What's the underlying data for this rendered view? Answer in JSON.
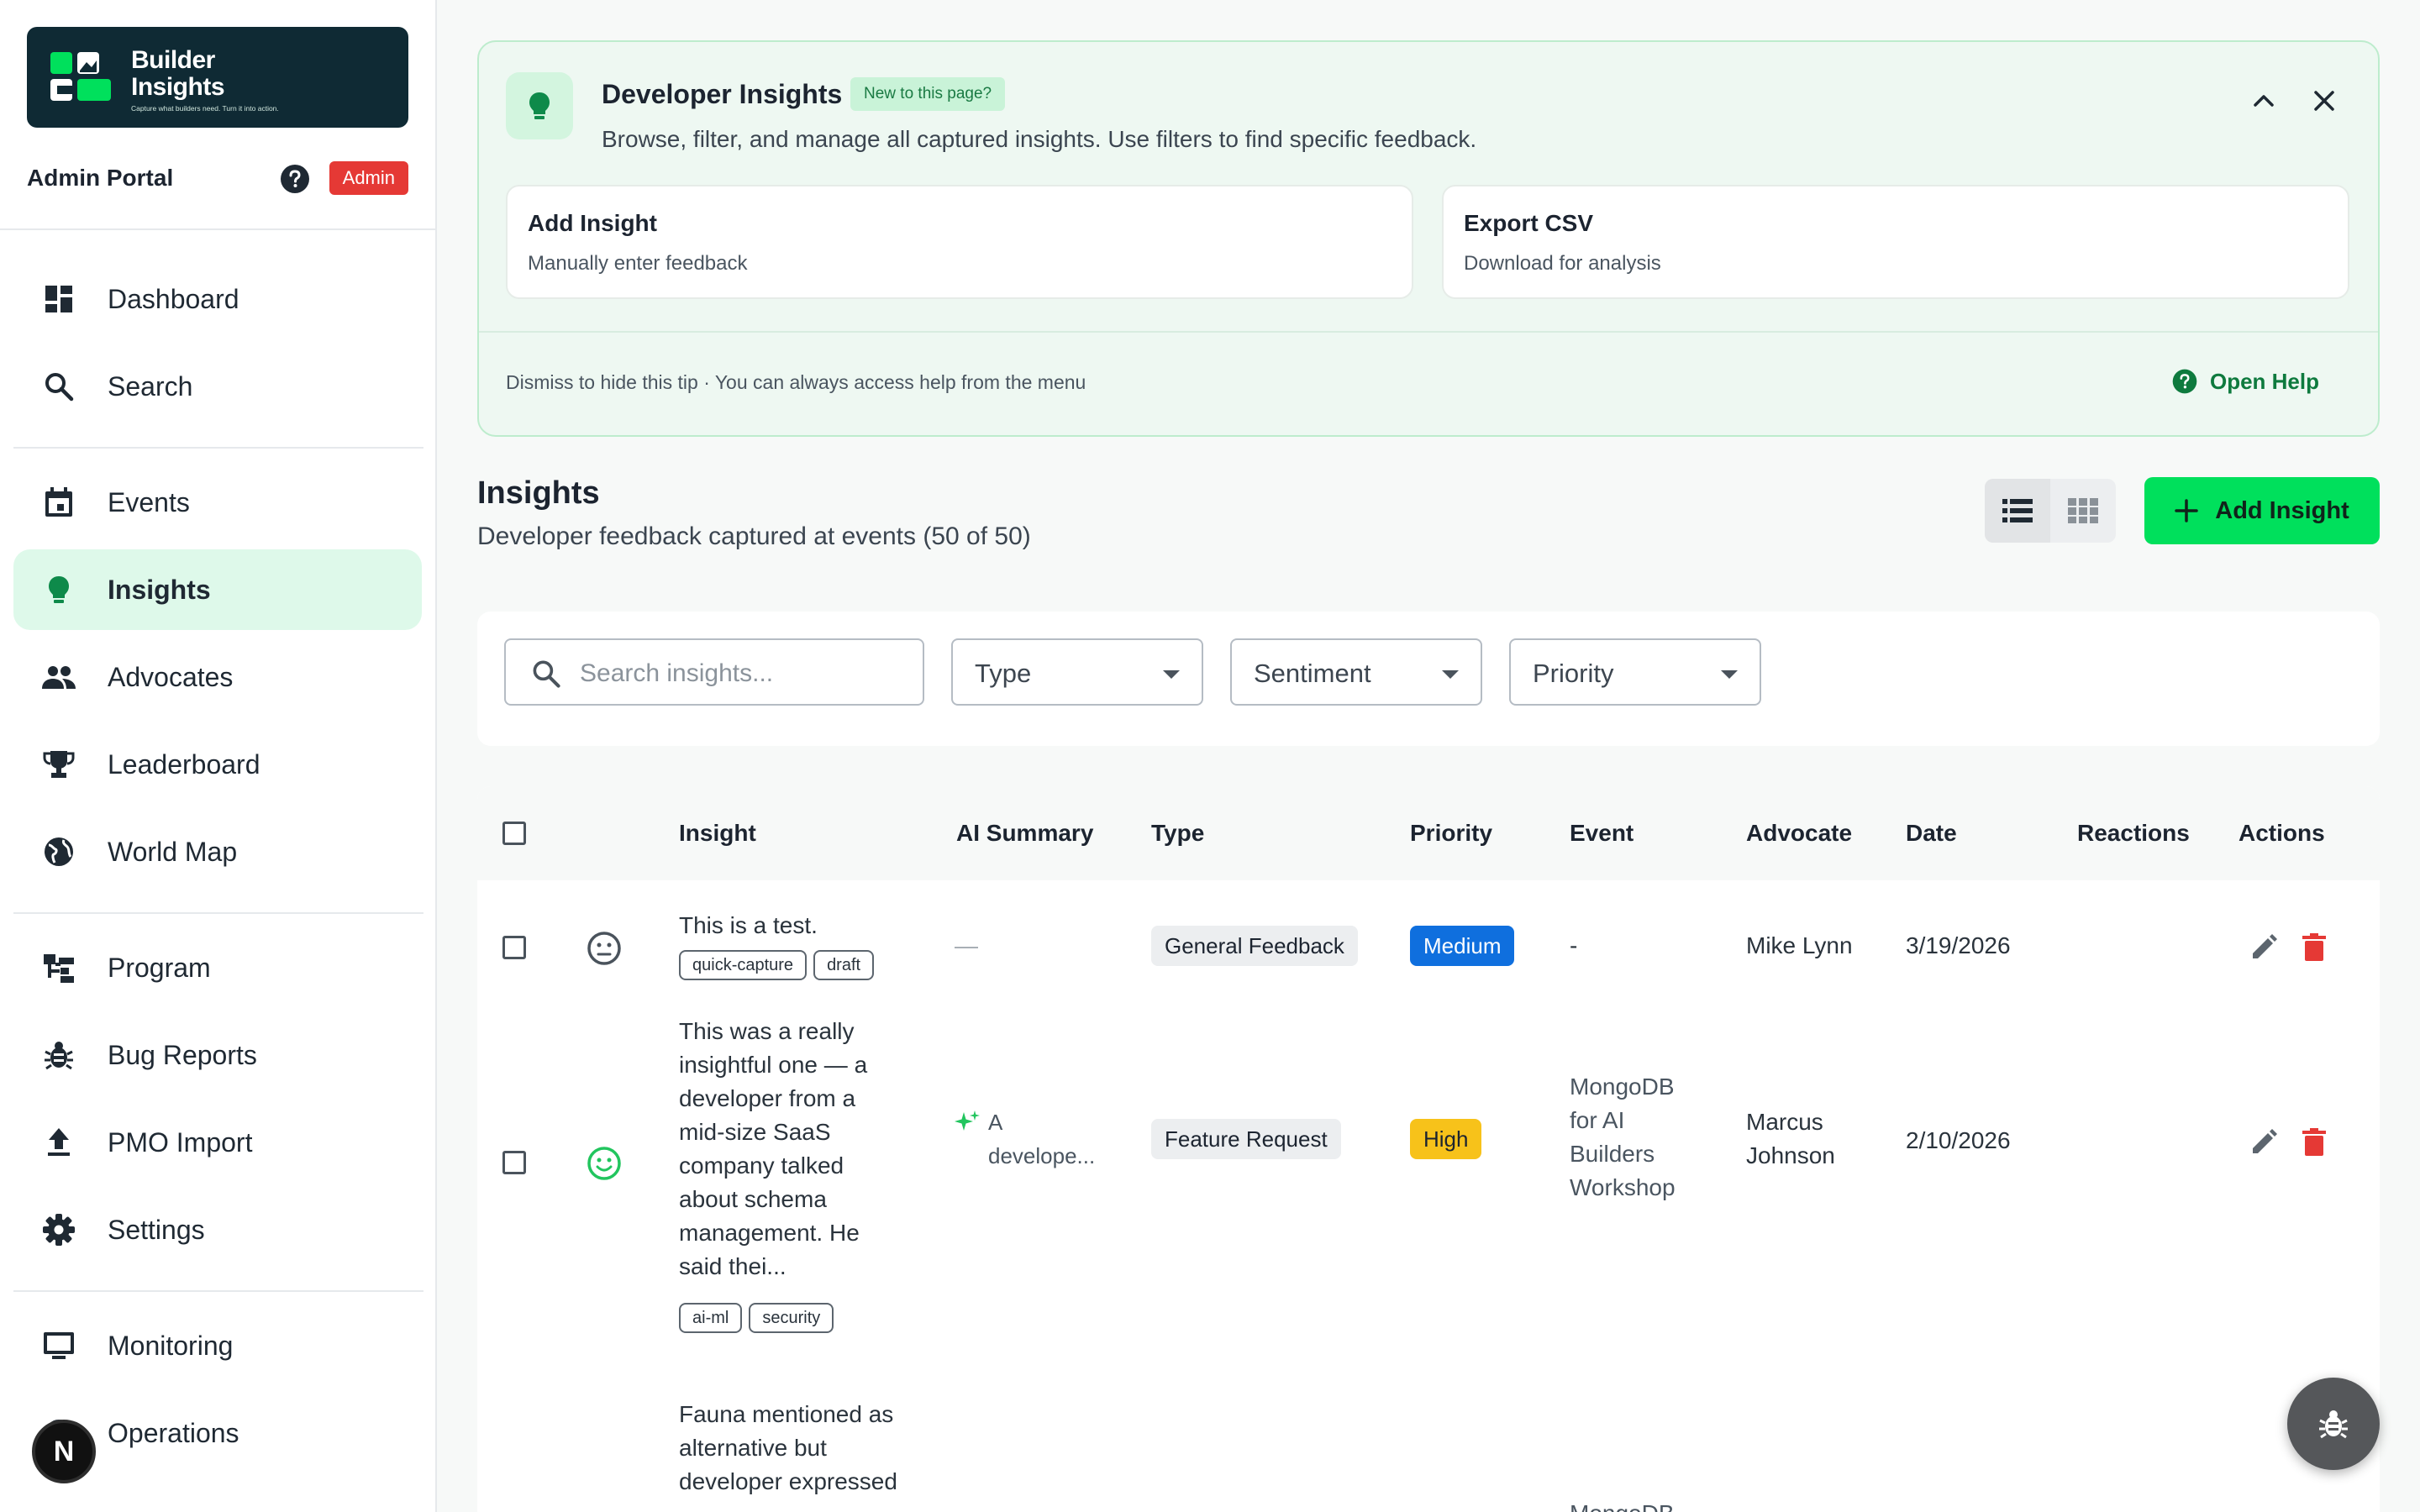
{
  "app": {
    "logo_title_line1": "Builder",
    "logo_title_line2": "Insights",
    "logo_tagline": "Capture what builders need. Turn it into action.",
    "portal_title": "Admin Portal",
    "role_badge": "Admin"
  },
  "sidebar": {
    "items": [
      {
        "label": "Dashboard",
        "icon": "dashboard-icon"
      },
      {
        "label": "Search",
        "icon": "search-icon"
      },
      {
        "label": "Events",
        "icon": "calendar-icon"
      },
      {
        "label": "Insights",
        "icon": "lightbulb-icon",
        "active": true
      },
      {
        "label": "Advocates",
        "icon": "people-icon"
      },
      {
        "label": "Leaderboard",
        "icon": "trophy-icon"
      },
      {
        "label": "World Map",
        "icon": "globe-icon"
      },
      {
        "label": "Program",
        "icon": "program-icon"
      },
      {
        "label": "Bug Reports",
        "icon": "bug-icon"
      },
      {
        "label": "PMO Import",
        "icon": "upload-icon"
      },
      {
        "label": "Settings",
        "icon": "gear-icon"
      },
      {
        "label": "Monitoring",
        "icon": "monitor-icon"
      },
      {
        "label": "Operations",
        "icon": "operations-icon"
      }
    ],
    "dev_badge": "N"
  },
  "tip": {
    "title": "Developer Insights",
    "badge": "New to this page?",
    "description": "Browse, filter, and manage all captured insights. Use filters to find specific feedback.",
    "actions": [
      {
        "title": "Add Insight",
        "subtitle": "Manually enter feedback"
      },
      {
        "title": "Export CSV",
        "subtitle": "Download for analysis"
      }
    ],
    "footer": "Dismiss to hide this tip · You can always access help from the menu",
    "help_label": "Open Help"
  },
  "page": {
    "title": "Insights",
    "subtitle": "Developer feedback captured at events (50 of 50)",
    "add_button": "Add Insight"
  },
  "filters": {
    "search_placeholder": "Search insights...",
    "type": "Type",
    "sentiment": "Sentiment",
    "priority": "Priority"
  },
  "table": {
    "columns": [
      "Insight",
      "AI Summary",
      "Type",
      "Priority",
      "Event",
      "Advocate",
      "Date",
      "Reactions",
      "Actions"
    ],
    "rows": [
      {
        "sentiment": "neutral",
        "insight": [
          "This is a test."
        ],
        "tags": [
          "quick-capture",
          "draft"
        ],
        "ai_summary": "—",
        "type": "General Feedback",
        "priority": "Medium",
        "event": [
          "-"
        ],
        "advocate": [
          "Mike Lynn"
        ],
        "date": "3/19/2026"
      },
      {
        "sentiment": "positive",
        "insight": [
          "This was a really",
          "insightful one — a",
          "developer from a",
          "mid-size SaaS",
          "company talked",
          "about schema",
          "management. He",
          "said thei..."
        ],
        "tags": [
          "ai-ml",
          "security"
        ],
        "ai_summary_line1": "A",
        "ai_summary_line2": "develope...",
        "type": "Feature Request",
        "priority": "High",
        "event": [
          "MongoDB",
          "for AI",
          "Builders",
          "Workshop"
        ],
        "advocate": [
          "Marcus",
          "Johnson"
        ],
        "date": "2/10/2026"
      },
      {
        "insight": [
          "Fauna mentioned as",
          "alternative but",
          "developer expressed"
        ],
        "event": [
          "MongoDB"
        ]
      }
    ]
  },
  "colors": {
    "accent": "#00e05c",
    "active_nav_bg": "#def9ea",
    "medium": "#0f6fde",
    "high": "#f7c21a",
    "danger": "#e53935"
  }
}
